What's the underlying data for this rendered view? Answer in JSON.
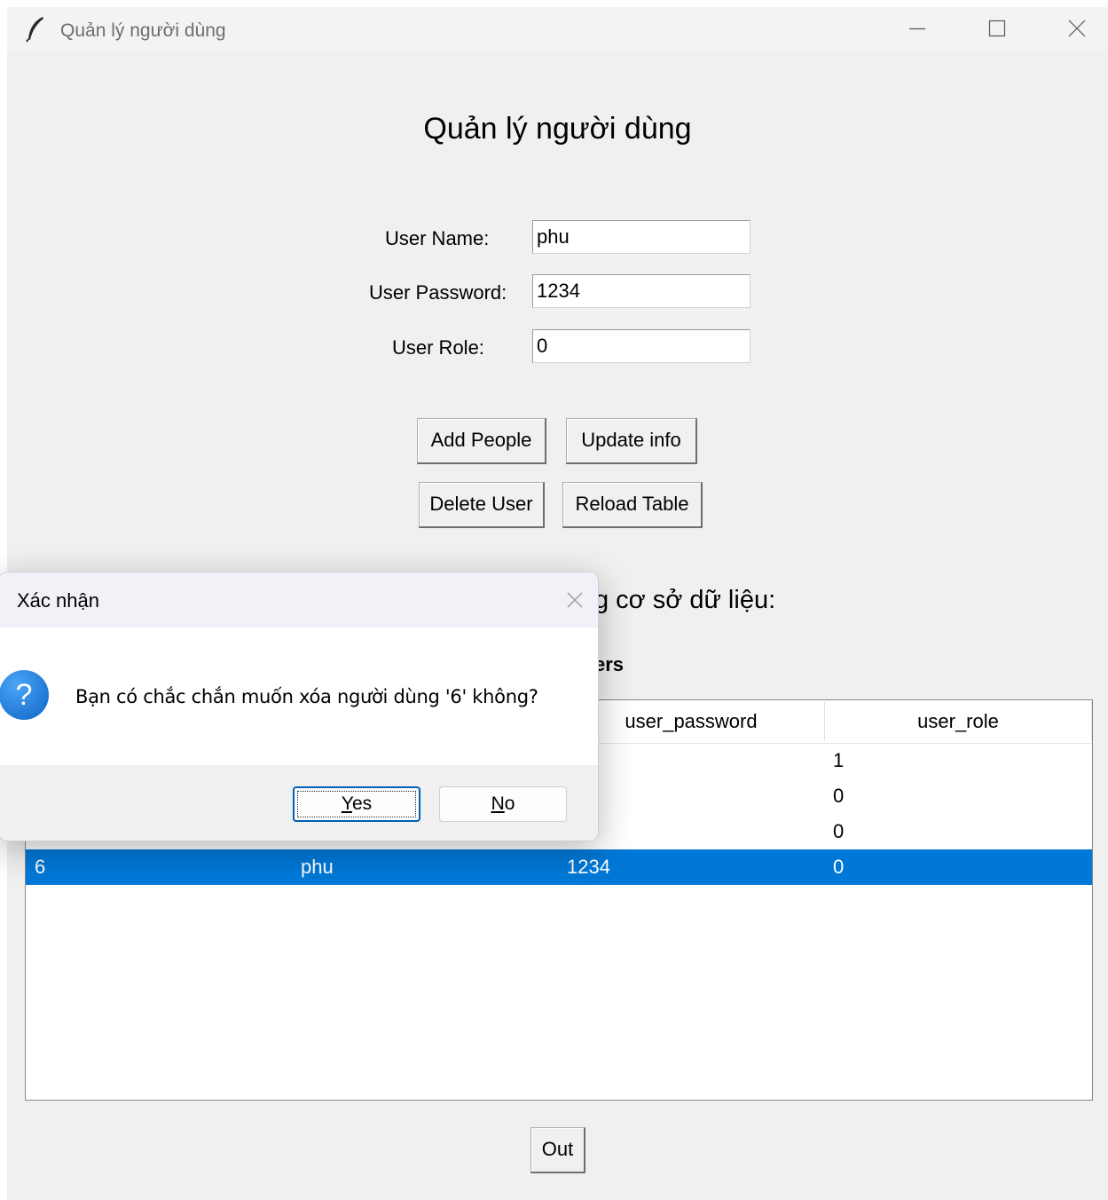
{
  "window": {
    "title": "Quản lý người dùng",
    "controls": {
      "minimize": "minimize-icon",
      "maximize": "maximize-icon",
      "close": "close-icon"
    }
  },
  "form": {
    "heading": "Quản lý người dùng",
    "fields": [
      {
        "label": "User Name:",
        "value": "phu"
      },
      {
        "label": "User Password:",
        "value": "1234"
      },
      {
        "label": "User Role:",
        "value": "0"
      }
    ]
  },
  "buttons": {
    "add": "Add People",
    "update": "Update info",
    "delete": "Delete User",
    "reload": "Reload Table",
    "out": "Out"
  },
  "section": {
    "partial_heading": "g cơ sở dữ liệu:",
    "table_caption_partial": "ers"
  },
  "table": {
    "visible_headers": [
      "user_password",
      "user_role"
    ],
    "rows": [
      {
        "id": "",
        "name": "",
        "password": "",
        "role": "1"
      },
      {
        "id": "",
        "name": "",
        "password": "",
        "role": "0"
      },
      {
        "id": "",
        "name": "",
        "password": "",
        "role": "0"
      },
      {
        "id": "6",
        "name": "phu",
        "password": "1234",
        "role": "0",
        "selected": true
      }
    ]
  },
  "dialog": {
    "title": "Xác nhận",
    "icon": "question-icon",
    "message": "Bạn có chắc chắn muốn xóa người dùng '6' không?",
    "yes_mnemonic": "Y",
    "yes_rest": "es",
    "no_mnemonic": "N",
    "no_rest": "o"
  },
  "colors": {
    "selection": "#0078d7",
    "window_bg": "#f0f0f0",
    "dialog_default_border": "#005fb8"
  }
}
